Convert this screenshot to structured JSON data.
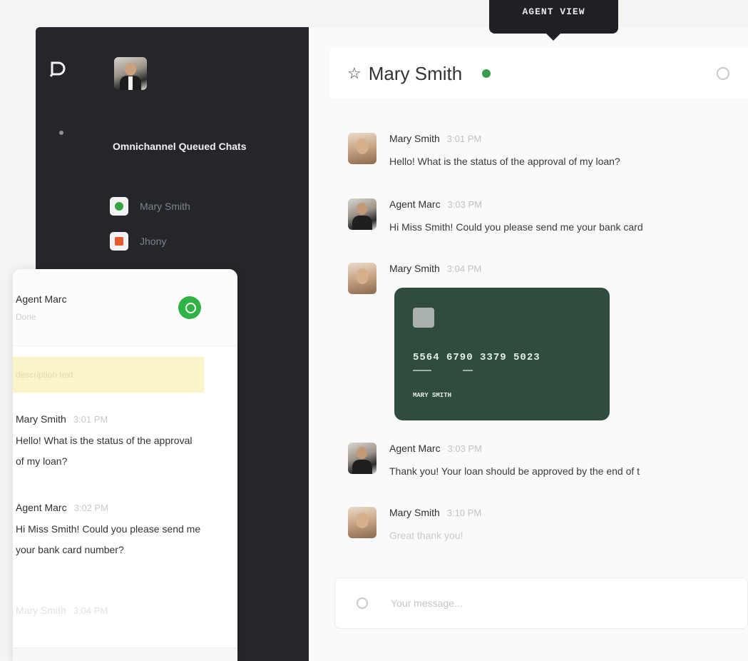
{
  "tooltip": {
    "label": "AGENT VIEW"
  },
  "sidebar": {
    "queue_title": "Omnichannel Queued Chats",
    "queue": [
      {
        "name": "Mary Smith",
        "channel": "whatsapp"
      },
      {
        "name": "Jhony",
        "channel": "gmail"
      }
    ]
  },
  "chat": {
    "contact_name": "Mary Smith",
    "status_color": "#3b9a4b",
    "messages": [
      {
        "sender": "Mary Smith",
        "time": "3:01 PM",
        "text": "Hello! What is the status of the approval of my loan?"
      },
      {
        "sender": "Agent Marc",
        "time": "3:03 PM",
        "text": "Hi Miss Smith! Could you please send me your bank card"
      },
      {
        "sender": "Mary Smith",
        "time": "3:04 PM",
        "text": ""
      },
      {
        "sender": "Agent Marc",
        "time": "3:03 PM",
        "text": "Thank you! Your loan should be approved by the end of t"
      },
      {
        "sender": "Mary Smith",
        "time": "3:10 PM",
        "text": "Great thank you!"
      }
    ],
    "card": {
      "number": "5564 6790 3379 5023",
      "holder": "MARY SMITH",
      "color": "#2f4c3e"
    },
    "composer_placeholder": "Your message..."
  },
  "whatsapp_panel": {
    "agent_name": "Agent Marc",
    "status": "Done",
    "banner_text": "description text",
    "messages": [
      {
        "sender": "Mary Smith",
        "time": "3:01 PM",
        "text": "Hello! What is the status of the approval of my loan?"
      },
      {
        "sender": "Agent Marc",
        "time": "3:02 PM",
        "text": "Hi Miss Smith! Could you please send me your bank card number?"
      },
      {
        "sender": "Mary Smith",
        "time": "3:04 PM",
        "text": ""
      }
    ],
    "icon_color": "#2fb344"
  }
}
